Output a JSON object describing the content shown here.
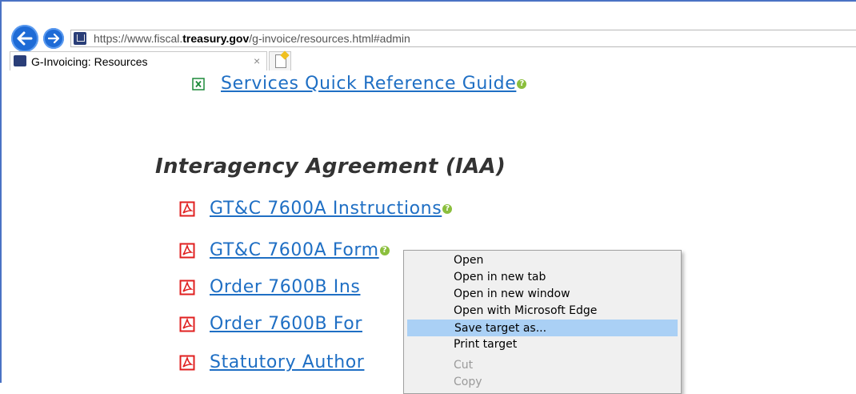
{
  "browser": {
    "back_label": "Back",
    "forward_label": "Forward",
    "url": {
      "scheme": "https://www.fiscal.",
      "domain_bold": "treasury.gov",
      "path": "/g-invoice/resources.html#admin"
    },
    "tab": {
      "title": "G-Invoicing: Resources",
      "close_glyph": "×"
    }
  },
  "page": {
    "top_link": {
      "label": "Services Quick Reference Guide",
      "icon": "excel-file-icon"
    },
    "section_heading": "Interagency Agreement (IAA)",
    "links": [
      {
        "label": "GT&C 7600A Instructions",
        "icon": "pdf-file-icon",
        "help": true
      },
      {
        "label": "GT&C 7600A Form",
        "icon": "pdf-file-icon",
        "help": true
      },
      {
        "label": "Order 7600B Ins",
        "icon": "pdf-file-icon",
        "help": false
      },
      {
        "label": "Order 7600B For",
        "icon": "pdf-file-icon",
        "help": false
      },
      {
        "label": "Statutory Author",
        "icon": "pdf-file-icon",
        "help": false
      }
    ],
    "help_glyph": "?"
  },
  "context_menu": {
    "items": [
      {
        "label": "Open",
        "state": "normal"
      },
      {
        "label": "Open in new tab",
        "state": "normal"
      },
      {
        "label": "Open in new window",
        "state": "normal"
      },
      {
        "label": "Open with Microsoft Edge",
        "state": "normal"
      },
      {
        "label": "Save target as...",
        "state": "highlighted"
      },
      {
        "label": "Print target",
        "state": "normal"
      },
      {
        "label": "Cut",
        "state": "disabled"
      },
      {
        "label": "Copy",
        "state": "disabled"
      }
    ]
  },
  "colors": {
    "link": "#1f6fc4",
    "nav_button": "#1e6bd6",
    "pdf_icon": "#e02020",
    "excel_icon": "#1d8a3a",
    "help_icon": "#8bbf3d",
    "menu_highlight": "#aad0f5"
  }
}
